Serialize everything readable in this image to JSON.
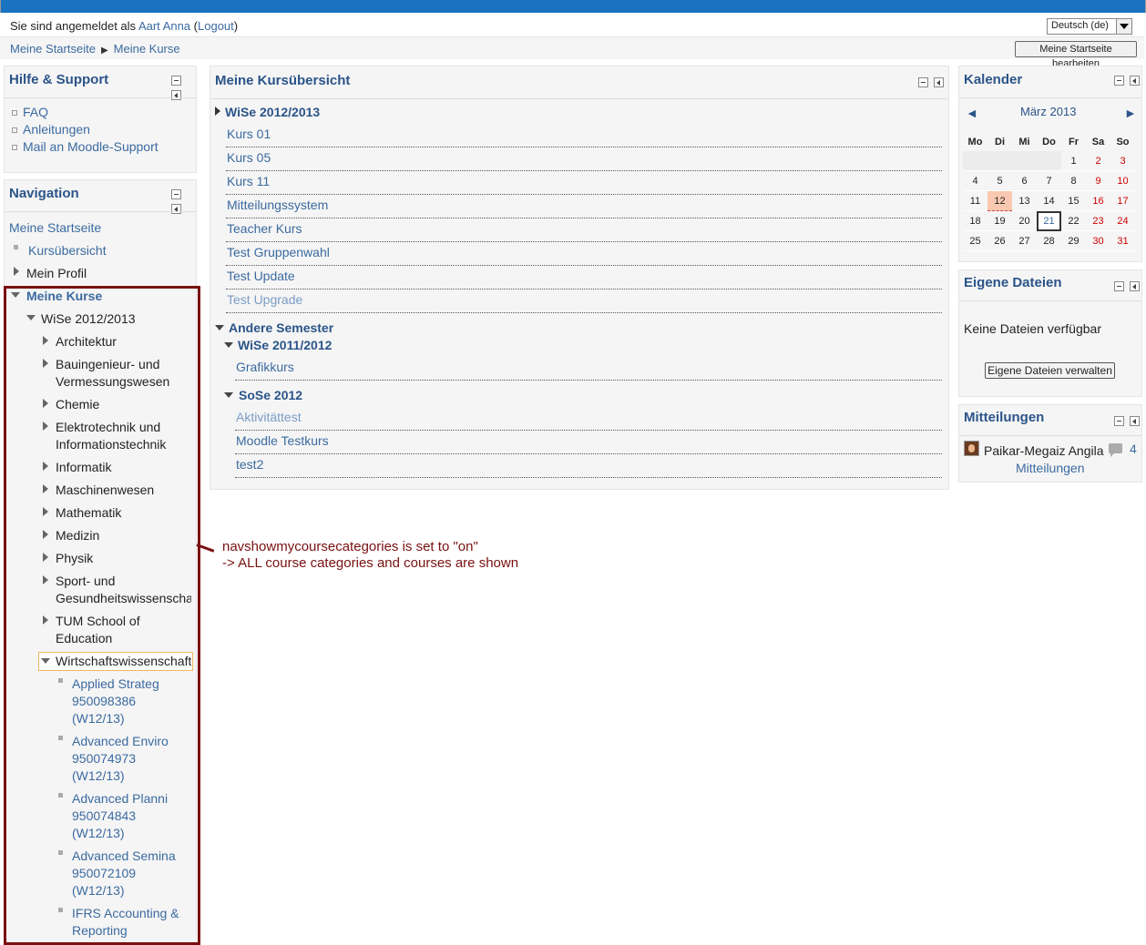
{
  "header": {
    "login_prefix": "Sie sind angemeldet als ",
    "user_name": "Aart Anna",
    "logout_open": " (",
    "logout_label": "Logout",
    "logout_close": ")",
    "language": "Deutsch (de)",
    "edit_button": "Meine Startseite bearbeiten"
  },
  "breadcrumb": {
    "home": "Meine Startseite",
    "current": "Meine Kurse"
  },
  "hilfe": {
    "title": "Hilfe & Support",
    "items": [
      "FAQ",
      "Anleitungen",
      "Mail an Moodle-Support"
    ]
  },
  "navigation": {
    "title": "Navigation",
    "home": "Meine Startseite",
    "kursuebersicht": "Kursübersicht",
    "profil": "Mein Profil",
    "meine_kurse": "Meine Kurse",
    "semester": "WiSe 2012/2013",
    "categories": [
      "Architektur",
      "Bauingenieur- und",
      "Vermessungswesen",
      "Chemie",
      "Elektrotechnik und",
      "Informationstechnik",
      "Informatik",
      "Maschinenwesen",
      "Mathematik",
      "Medizin",
      "Physik",
      "Sport- und",
      "Gesundheitswissenscha",
      "TUM School of",
      "Education",
      "Wirtschaftswissenschaft"
    ],
    "courses": [
      [
        "Applied Strateg",
        "950098386",
        "(W12/13)"
      ],
      [
        "Advanced Enviro",
        "950074973",
        "(W12/13)"
      ],
      [
        "Advanced Planni",
        "950074843",
        "(W12/13)"
      ],
      [
        "Advanced Semina",
        "950072109",
        "(W12/13)"
      ],
      [
        "IFRS Accounting &",
        "Reporting"
      ]
    ]
  },
  "overview": {
    "title": "Meine Kursübersicht",
    "current_semester": "WiSe 2012/2013",
    "current_courses": [
      "Kurs 01",
      "Kurs 05",
      "Kurs 11",
      "Mitteilungssystem",
      "Teacher Kurs",
      "Test Gruppenwahl",
      "Test Update",
      "Test Upgrade"
    ],
    "other": "Andere Semester",
    "sem2": "WiSe 2011/2012",
    "sem2_courses": [
      "Grafikkurs"
    ],
    "sem3": "SoSe 2012",
    "sem3_courses": [
      "Aktivitättest",
      "Moodle Testkurs",
      "test2"
    ]
  },
  "calendar": {
    "title": "Kalender",
    "month": "März 2013",
    "prev": "◄",
    "next": "►",
    "days": [
      "Mo",
      "Di",
      "Mi",
      "Do",
      "Fr",
      "Sa",
      "So"
    ],
    "weeks": [
      [
        "",
        "",
        "",
        "",
        "1",
        "2",
        "3"
      ],
      [
        "4",
        "5",
        "6",
        "7",
        "8",
        "9",
        "10"
      ],
      [
        "11",
        "12",
        "13",
        "14",
        "15",
        "16",
        "17"
      ],
      [
        "18",
        "19",
        "20",
        "21",
        "22",
        "23",
        "24"
      ],
      [
        "25",
        "26",
        "27",
        "28",
        "29",
        "30",
        "31"
      ]
    ]
  },
  "files": {
    "title": "Eigene Dateien",
    "empty": "Keine Dateien verfügbar",
    "button": "Eigene Dateien verwalten"
  },
  "messages": {
    "title": "Mitteilungen",
    "user": "Paikar-Megaiz Angila",
    "count": "4",
    "link": "Mitteilungen"
  },
  "annotation": {
    "line1": "navshowmycoursecategories is set to \"on\"",
    "line2": "-> ALL course categories and courses are shown"
  },
  "colors": {
    "accent": "#2b5489",
    "link": "#3b6aa0",
    "annotation": "#7a1010",
    "topbar": "#1a73c0"
  }
}
